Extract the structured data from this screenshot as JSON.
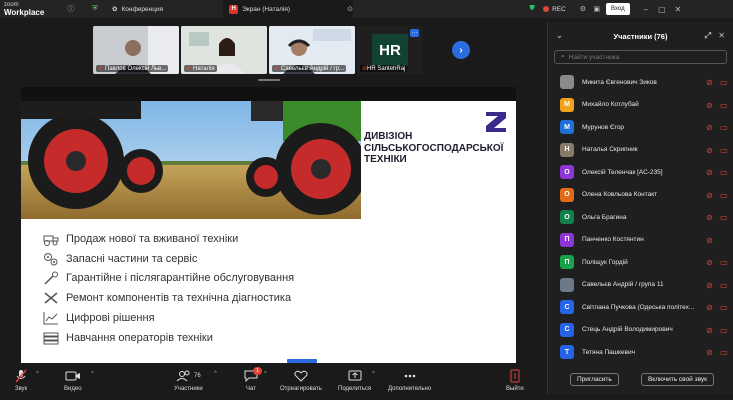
{
  "app": {
    "logo_line1": "zoom",
    "logo_line2": "Workplace",
    "tabs": [
      {
        "label": "Конференция"
      },
      {
        "label": "Экран (Наталія)",
        "badge": "H"
      }
    ],
    "rec_label": "REC",
    "sign_in": "Вход"
  },
  "videos": [
    {
      "name": "Павлов Олексій Льв..."
    },
    {
      "name": "Наталія"
    },
    {
      "name": "Савельєв Андрій / гр..."
    },
    {
      "name": "HR SantehRaj",
      "initials": "HR"
    }
  ],
  "slide": {
    "title_lines": [
      "ДИВІЗІОН",
      "СІЛЬСЬКОГОСПОДАРСЬКОЇ",
      "ТЕХНІКИ"
    ],
    "items": [
      {
        "icon": "tractor-icon",
        "label": "Продаж нової та вживаної техніки"
      },
      {
        "icon": "gears-icon",
        "label": "Запасні частини та сервіс"
      },
      {
        "icon": "wrench-icon",
        "label": "Гарантійне і післягарантійне обслуговування"
      },
      {
        "icon": "tools-icon",
        "label": "Ремонт компонентів та технічна діагностика"
      },
      {
        "icon": "chart-icon",
        "label": "Цифрові рішення"
      },
      {
        "icon": "books-icon",
        "label": "Навчання операторів техніки"
      }
    ]
  },
  "panel": {
    "title": "Участники (76)",
    "search_placeholder": "Найти участника",
    "participants": [
      {
        "initial": "",
        "color": "#8a8a8a",
        "name": "Микита Євгенович Зиков",
        "video": true
      },
      {
        "initial": "М",
        "color": "#f0a21c",
        "name": "Михайло Котлубай",
        "video": true
      },
      {
        "initial": "М",
        "color": "#1f6fd6",
        "name": "Мурунов Єгор",
        "video": true
      },
      {
        "initial": "Н",
        "color": "#8a7a6a",
        "name": "Наталья Скрипник",
        "video": true
      },
      {
        "initial": "О",
        "color": "#8e35d8",
        "name": "Олексій Теленчак [АС-235]",
        "video": true
      },
      {
        "initial": "О",
        "color": "#e36a16",
        "name": "Олена Ковльова Контакт",
        "video": true
      },
      {
        "initial": "О",
        "color": "#12804a",
        "name": "Ольга Брагина",
        "video": true
      },
      {
        "initial": "П",
        "color": "#8e35d8",
        "name": "Панченко Костянтин",
        "video": false
      },
      {
        "initial": "П",
        "color": "#16a34a",
        "name": "Поліщук Гордій",
        "video": true
      },
      {
        "initial": "",
        "color": "#6b7a86",
        "name": "Савельєв Андрій / група 11",
        "video": true
      },
      {
        "initial": "С",
        "color": "#2563eb",
        "name": "Світлана Пучкова (Одеська політех...",
        "video": true
      },
      {
        "initial": "С",
        "color": "#2563eb",
        "name": "Стець Андрій Володимирович",
        "video": true
      },
      {
        "initial": "Т",
        "color": "#2563eb",
        "name": "Тетяна Пашкевич",
        "video": true
      }
    ],
    "invite": "Пригласить",
    "unmute": "Включить свой звук"
  },
  "toolbar": {
    "audio": "Звук",
    "video": "Видео",
    "participants": "Участники",
    "participants_count": "76",
    "chat": "Чат",
    "chat_badge": "1",
    "react": "Отреагировать",
    "share": "Поделиться",
    "more": "Дополнительно",
    "leave": "Выйти"
  },
  "colors": {
    "accent": "#2b6de0",
    "danger": "#e0453a",
    "hr_tile": "#124234",
    "brand": "#3b2a8a"
  }
}
